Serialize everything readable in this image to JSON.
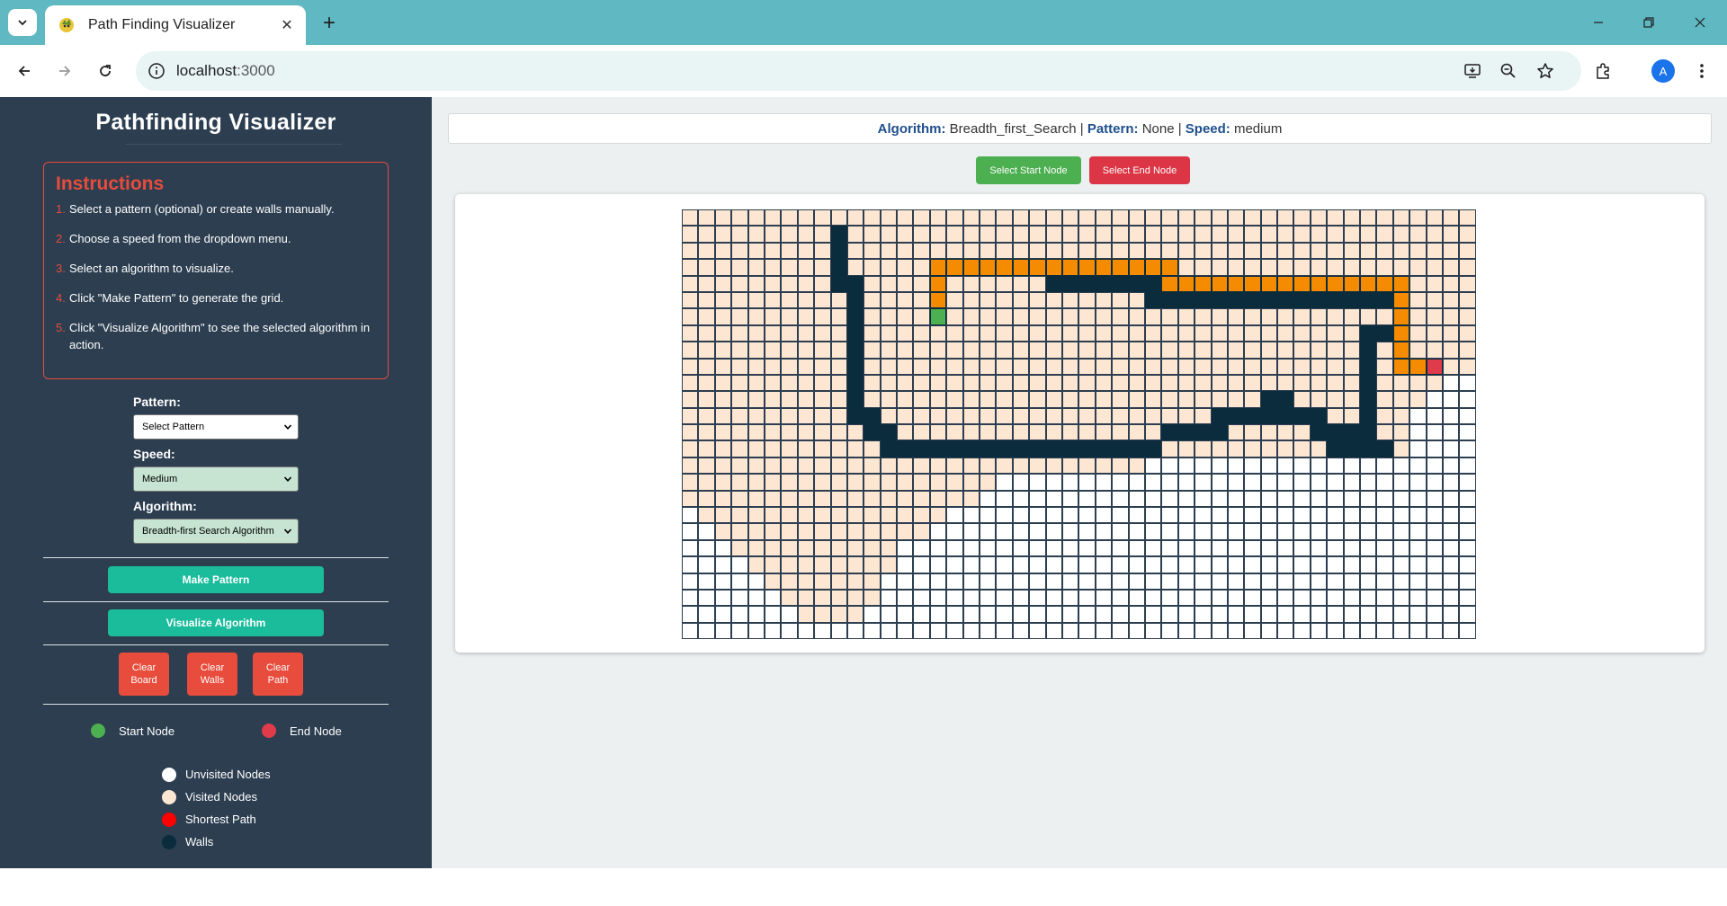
{
  "browser": {
    "tab_title": "Path Finding Visualizer",
    "url_host": "localhost",
    "url_port": ":3000",
    "avatar_letter": "A"
  },
  "sidebar": {
    "title": "Pathfinding Visualizer",
    "instructions": {
      "heading": "Instructions",
      "steps": [
        {
          "num": "1.",
          "text": "Select a pattern (optional) or create walls manually."
        },
        {
          "num": "2.",
          "text": "Choose a speed from the dropdown menu."
        },
        {
          "num": "3.",
          "text": "Select an algorithm to visualize."
        },
        {
          "num": "4.",
          "text": "Click \"Make Pattern\" to generate the grid."
        },
        {
          "num": "5.",
          "text": "Click \"Visualize Algorithm\" to see the selected algorithm in action."
        }
      ]
    },
    "pattern": {
      "label": "Pattern:",
      "value": "Select Pattern"
    },
    "speed": {
      "label": "Speed:",
      "value": "Medium"
    },
    "algorithm": {
      "label": "Algorithm:",
      "value": "Breadth-first Search Algorithm"
    },
    "make_pattern_label": "Make Pattern",
    "visualize_label": "Visualize Algorithm",
    "clear_board_label": "Clear Board",
    "clear_walls_label": "Clear Walls",
    "clear_path_label": "Clear Path",
    "start_node_label": "Start Node",
    "end_node_label": "End Node",
    "legend": [
      {
        "label": "Unvisited Nodes",
        "color": "#ffffff"
      },
      {
        "label": "Visited Nodes",
        "color": "#fde6d2"
      },
      {
        "label": "Shortest Path",
        "color": "#ff0000"
      },
      {
        "label": "Walls",
        "color": "#0b2c3d"
      }
    ]
  },
  "status": {
    "algorithm_label": "Algorithm:",
    "algorithm_value": "Breadth_first_Search",
    "pattern_label": "Pattern:",
    "pattern_value": "None",
    "speed_label": "Speed:",
    "speed_value": "medium"
  },
  "buttons": {
    "select_start_label": "Select Start Node",
    "select_end_label": "Select End Node"
  },
  "colors": {
    "sidebar_bg": "#2c3e50",
    "accent_red": "#e74c3c",
    "accent_teal": "#1abc9c",
    "start_green": "#4caf50",
    "end_red": "#e03b4a",
    "wall": "#0b2c3d",
    "path": "#f58b00",
    "visited": "#fde6d2"
  },
  "grid": {
    "rows": 26,
    "cols": 48,
    "legend": "u=unvisited v=visited w=wall p=shortest-path s=start e=end",
    "cells": [
      "vvvvvvvvvvvvvvvvvvvvvvvvvvvvvvvvvvvvvvvvvvvvvvvv",
      "vvvvvvvvvwvvvvvvvvvvvvvvvvvvvvvvvvvvvvvvvvvvvvvv",
      "vvvvvvvvvwvvvvvvvvvvvvvvvvvvvvvvvvvvvvvvvvvvvvvv",
      "vvvvvvvvvwvvvvvpppppppppppppppvvvvvvvvvvvvvvvvvv",
      "vvvvvvvvvwwvvvvpvvvvvvwwwwwwwpppppppppppppppvvvv",
      "vvvvvvvvvvwvvvvpvvvvvvvvvvvvwwwwwwwwwwwwwwwpvvvv",
      "vvvvvvvvvvwvvvvsvvvvvvvvvvvvvvvvvvvvvvvvvvvpvvvv",
      "vvvvvvvvvvwvvvvvvvvvvvvvvvvvvvvvvvvvvvvvvwwpvvvv",
      "vvvvvvvvvvwvvvvvvvvvvvvvvvvvvvvvvvvvvvvvvwvpvvvv",
      "vvvvvvvvvvwvvvvvvvvvvvvvvvvvvvvvvvvvvvvvvwvppevv",
      "vvvvvvvvvvwvvvvvvvvvvvvvvvvvvvvvvvvvvvvvvwvvvvuu",
      "vvvvvvvvvvwvvvvvvvvvvvvvvvvvvvvvvvvwwvvvvwvvvuuu",
      "vvvvvvvvvvwwvvvvvvvvvvvvvvvvvvvvwwwwwwwvvwvvuuuu",
      "vvvvvvvvvvvwwvvvvvvvvvvvvvvvvwwwwvvvvvwwwwvvuuuu",
      "vvvvvvvvvvvvwwwwwwwwwwwwwwwwwvvvvvvvvvvwwwwvuuuu",
      "vvvvvvvvvvvvvvvvvvvvvvvvvvvvuuuuuuuuuuuuuuuuuuuu",
      "vvvvvvvvvvvvvvvvvvvuuuuuuuuuuuuuuuuuuuuuuuuuuuuu",
      "vvvvvvvvvvvvvvvvvvuuuuuuuuuuuuuuuuuuuuuuuuuuuuuu",
      "uvvvvvvvvvvvvvvvuuuuuuuuuuuuuuuuuuuuuuuuuuuuuuuu",
      "uuvvvvvvvvvvvvvuuuuuuuuuuuuuuuuuuuuuuuuuuuuuuuuu",
      "uuuvvvvvvvvvvuuuuuuuuuuuuuuuuuuuuuuuuuuuuuuuuuuu",
      "uuuuvvvvvvvvvuuuuuuuuuuuuuuuuuuuuuuuuuuuuuuuuuuu",
      "uuuuuvvvvvvvuuuuuuuuuuuuuuuuuuuuuuuuuuuuuuuuuuuu",
      "uuuuuuvvvvvvuuuuuuuuuuuuuuuuuuuuuuuuuuuuuuuuuuuu",
      "uuuuuuuvvvvuuuuuuuuuuuuuuuuuuuuuuuuuuuuuuuuuuuuu",
      "uuuuuuuuuuuuuuuuuuuuuuuuuuuuuuuuuuuuuuuuuuuuuuuu"
    ]
  }
}
